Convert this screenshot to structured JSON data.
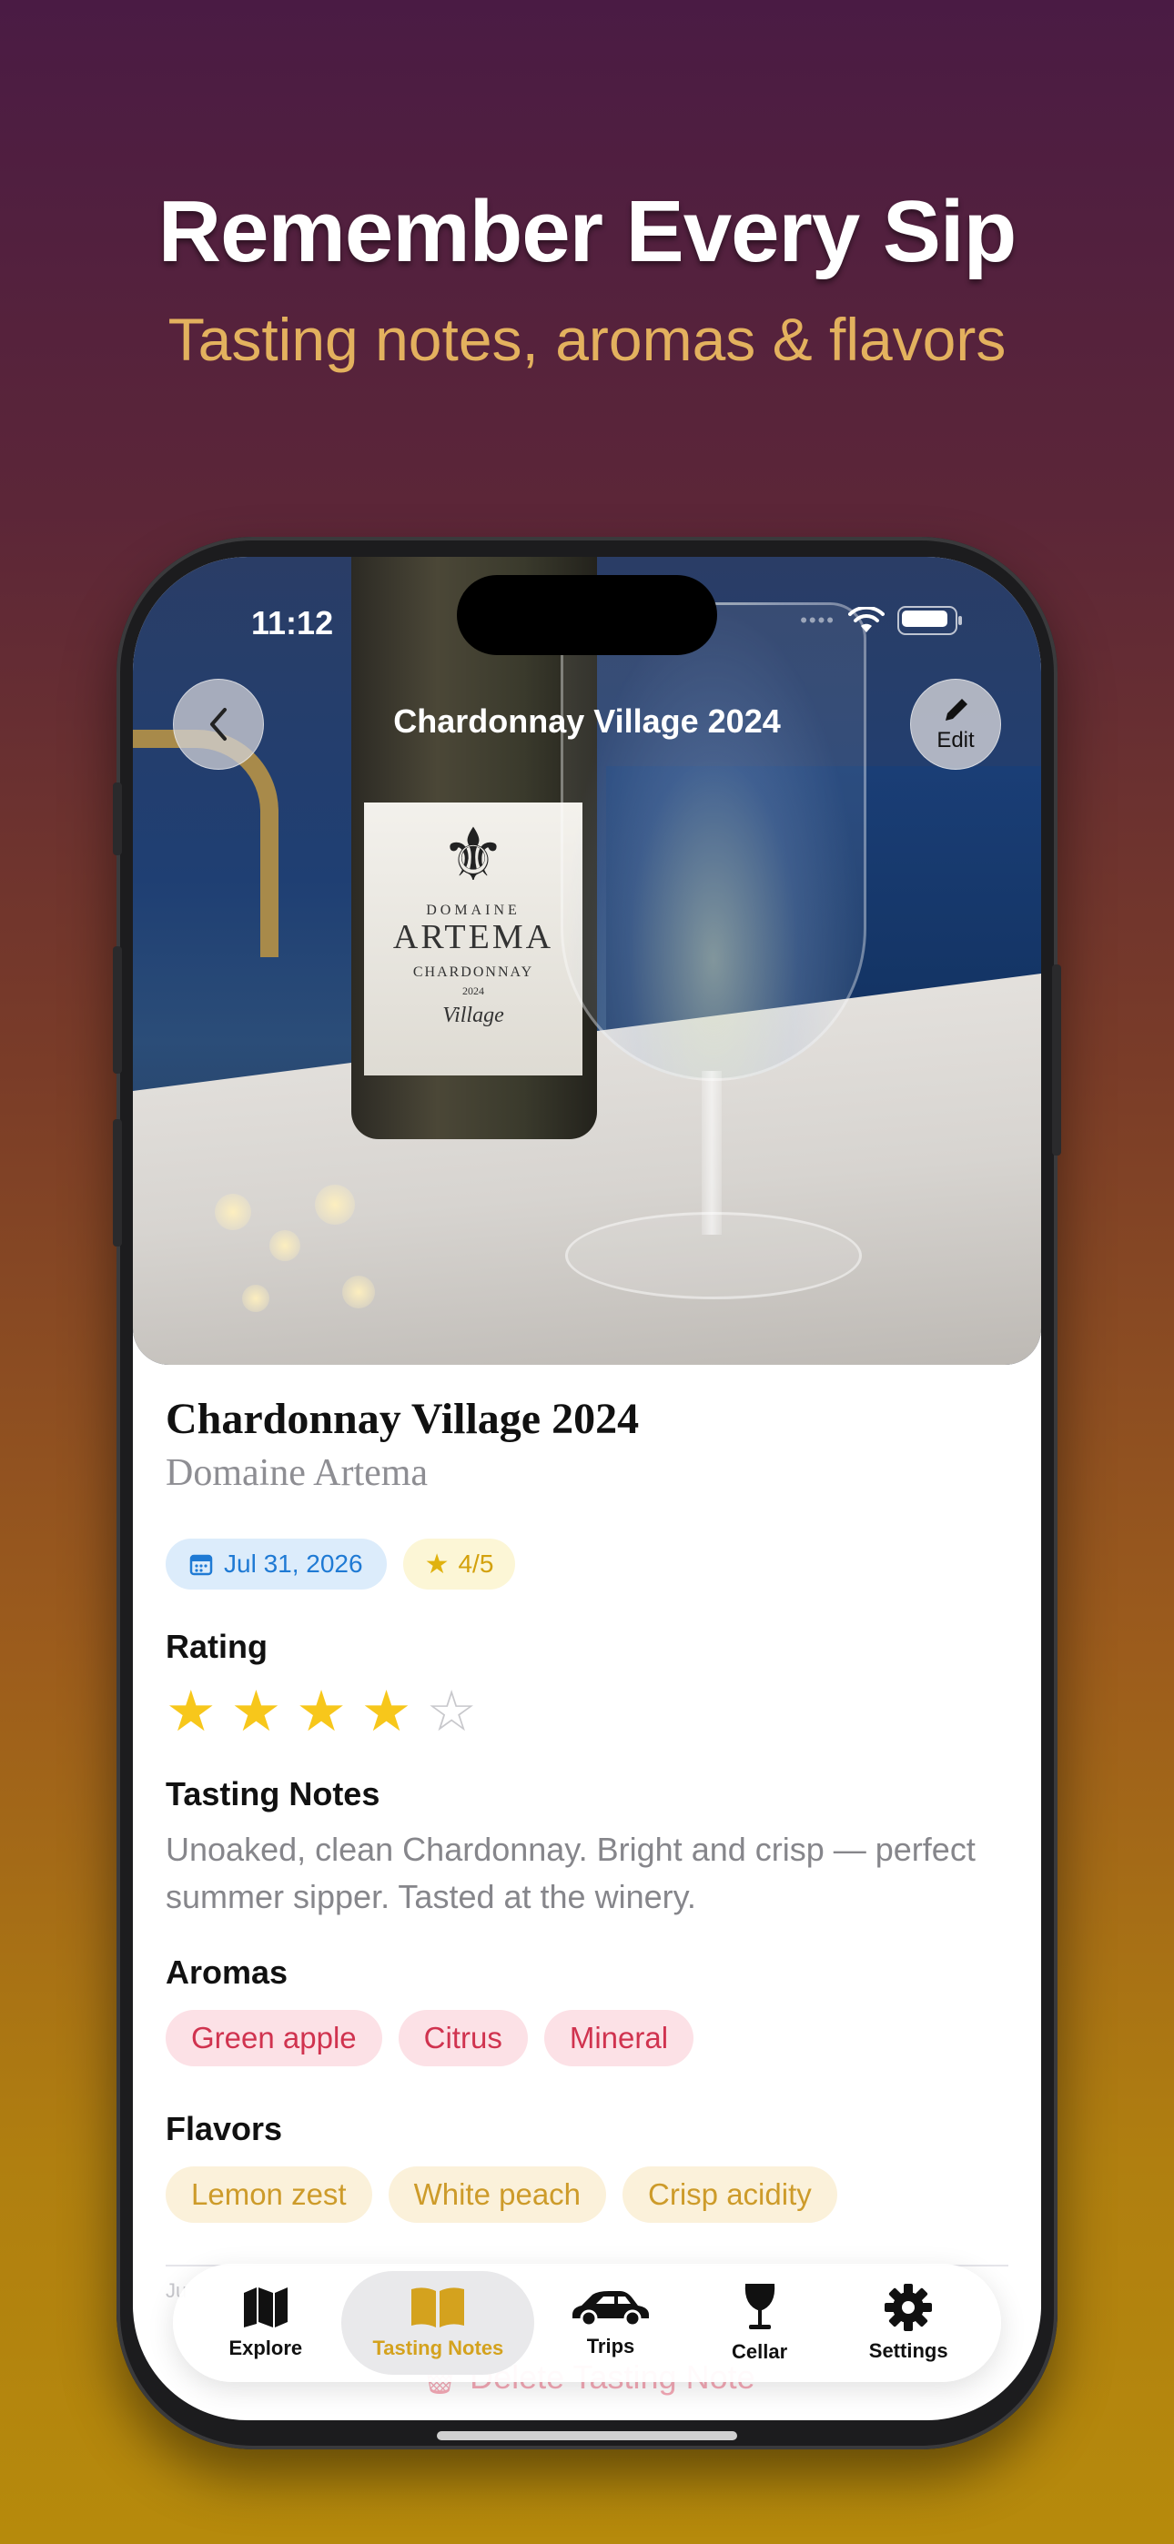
{
  "promo": {
    "headline": "Remember Every Sip",
    "subheadline": "Tasting notes, aromas & flavors"
  },
  "status_bar": {
    "time": "11:12"
  },
  "nav": {
    "title": "Chardonnay Village 2024",
    "edit_label": "Edit"
  },
  "photo": {
    "label_domaine": "DOMAINE",
    "label_name": "ARTEMA",
    "label_varietal": "CHARDONNAY",
    "label_year": "2024",
    "label_cuvee": "Village"
  },
  "wine": {
    "name": "Chardonnay Village 2024",
    "winery": "Domaine Artema",
    "date": "Jul 31, 2026",
    "rating_badge": "4/5",
    "rating": 4,
    "rating_max": 5
  },
  "sections": {
    "rating": "Rating",
    "tasting_notes": "Tasting Notes",
    "aromas": "Aromas",
    "flavors": "Flavors"
  },
  "tasting_notes": "Unoaked, clean Chardonnay. Bright and crisp — perfect summer sipper. Tasted at the winery.",
  "aromas": [
    "Green apple",
    "Citrus",
    "Mineral"
  ],
  "flavors": [
    "Lemon zest",
    "White peach",
    "Crisp acidity"
  ],
  "footer": {
    "partial_date": "Ju",
    "delete_label": "Delete Tasting Note"
  },
  "tabs": [
    {
      "label": "Explore",
      "icon": "map-icon",
      "active": false
    },
    {
      "label": "Tasting Notes",
      "icon": "book-icon",
      "active": true
    },
    {
      "label": "Trips",
      "icon": "car-icon",
      "active": false
    },
    {
      "label": "Cellar",
      "icon": "wine-glass-icon",
      "active": false
    },
    {
      "label": "Settings",
      "icon": "gear-icon",
      "active": false
    }
  ],
  "colors": {
    "accent_gold": "#d4a21e",
    "star": "#f7c71b",
    "aroma_text": "#d0334f",
    "date_chip_text": "#1f7ad4"
  }
}
